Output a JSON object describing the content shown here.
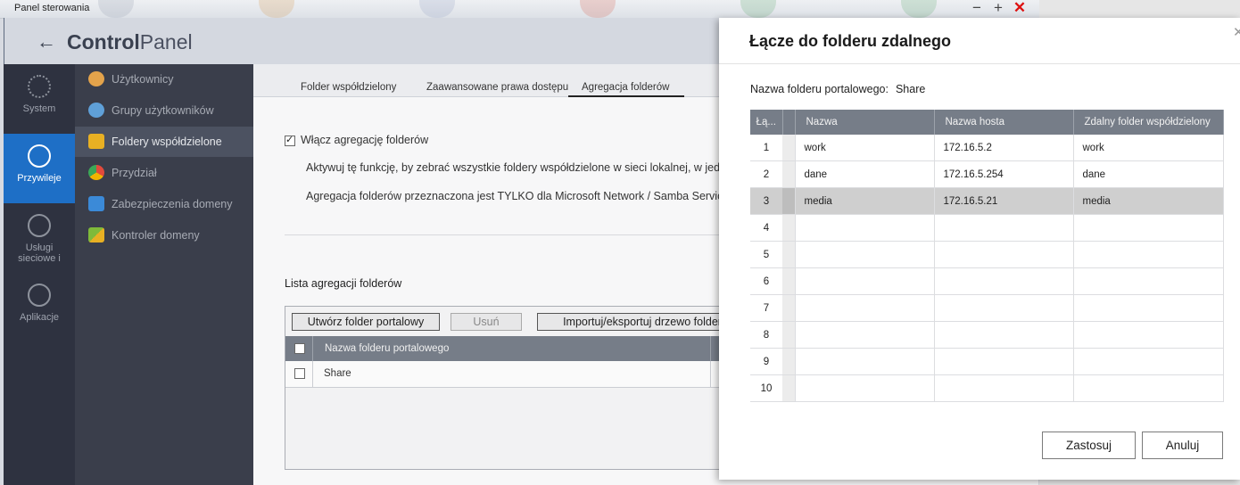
{
  "window": {
    "title": "Panel sterowania",
    "controls": [
      "−",
      "+",
      "✕"
    ]
  },
  "header": {
    "back_icon": "arrow-left-icon",
    "title_bold": "Control",
    "title_light": "Panel"
  },
  "leftnav": [
    {
      "label": "System",
      "icon": "gear-icon"
    },
    {
      "label": "Przywileje",
      "icon": "user-icon",
      "active": true
    },
    {
      "label": "Usługi sieciowe i",
      "icon": "globe-icon"
    },
    {
      "label": "Aplikacje",
      "icon": "apps-icon"
    }
  ],
  "subnav": [
    {
      "label": "Użytkownicy",
      "icon": "user-icon",
      "color": "#e3a34b"
    },
    {
      "label": "Grupy użytkowników",
      "icon": "users-icon",
      "color": "#5fa0d8"
    },
    {
      "label": "Foldery współdzielone",
      "icon": "shared-folder-icon",
      "color": "#e8b023",
      "active": true
    },
    {
      "label": "Przydział",
      "icon": "quota-icon",
      "color": "#e24a3c"
    },
    {
      "label": "Zabezpieczenia domeny",
      "icon": "domain-security-icon",
      "color": "#3b8ad8"
    },
    {
      "label": "Kontroler domeny",
      "icon": "domain-controller-icon",
      "color": "#7fba3a"
    }
  ],
  "tabs": [
    {
      "label": "Folder współdzielony"
    },
    {
      "label": "Zaawansowane prawa dostępu"
    },
    {
      "label": "Agregacja folderów",
      "active": true
    }
  ],
  "content": {
    "enable_label": "Włącz agregację folderów",
    "enable_checked": true,
    "desc1": "Aktywuj tę funkcję, by zebrać wszystkie foldery współdzielone w sieci lokalnej, w jeder",
    "desc2": "Agregacja folderów przeznaczona jest TYLKO dla Microsoft Network / Samba Service.",
    "list_title": "Lista agregacji folderów",
    "buttons": {
      "create": "Utwórz folder portalowy",
      "delete": "Usuń",
      "import": "Importuj/eksportuj drzewo folderów"
    },
    "list_header": "Nazwa folderu portalowego",
    "list_rows": [
      "Share"
    ]
  },
  "dialog": {
    "title": "Łącze do folderu zdalnego",
    "field_label": "Nazwa folderu portalowego:",
    "field_value": "Share",
    "columns": [
      "Łą...",
      "Nazwa",
      "Nazwa hosta",
      "Zdalny folder współdzielony"
    ],
    "rows": [
      {
        "num": "1",
        "name": "work",
        "host": "172.16.5.2",
        "remote": "work"
      },
      {
        "num": "2",
        "name": "dane",
        "host": "172.16.5.254",
        "remote": "dane"
      },
      {
        "num": "3",
        "name": "media",
        "host": "172.16.5.21",
        "remote": "media",
        "selected": true
      },
      {
        "num": "4",
        "name": "",
        "host": "",
        "remote": ""
      },
      {
        "num": "5",
        "name": "",
        "host": "",
        "remote": ""
      },
      {
        "num": "6",
        "name": "",
        "host": "",
        "remote": ""
      },
      {
        "num": "7",
        "name": "",
        "host": "",
        "remote": ""
      },
      {
        "num": "8",
        "name": "",
        "host": "",
        "remote": ""
      },
      {
        "num": "9",
        "name": "",
        "host": "",
        "remote": ""
      },
      {
        "num": "10",
        "name": "",
        "host": "",
        "remote": ""
      }
    ],
    "apply": "Zastosuj",
    "cancel": "Anuluj"
  }
}
